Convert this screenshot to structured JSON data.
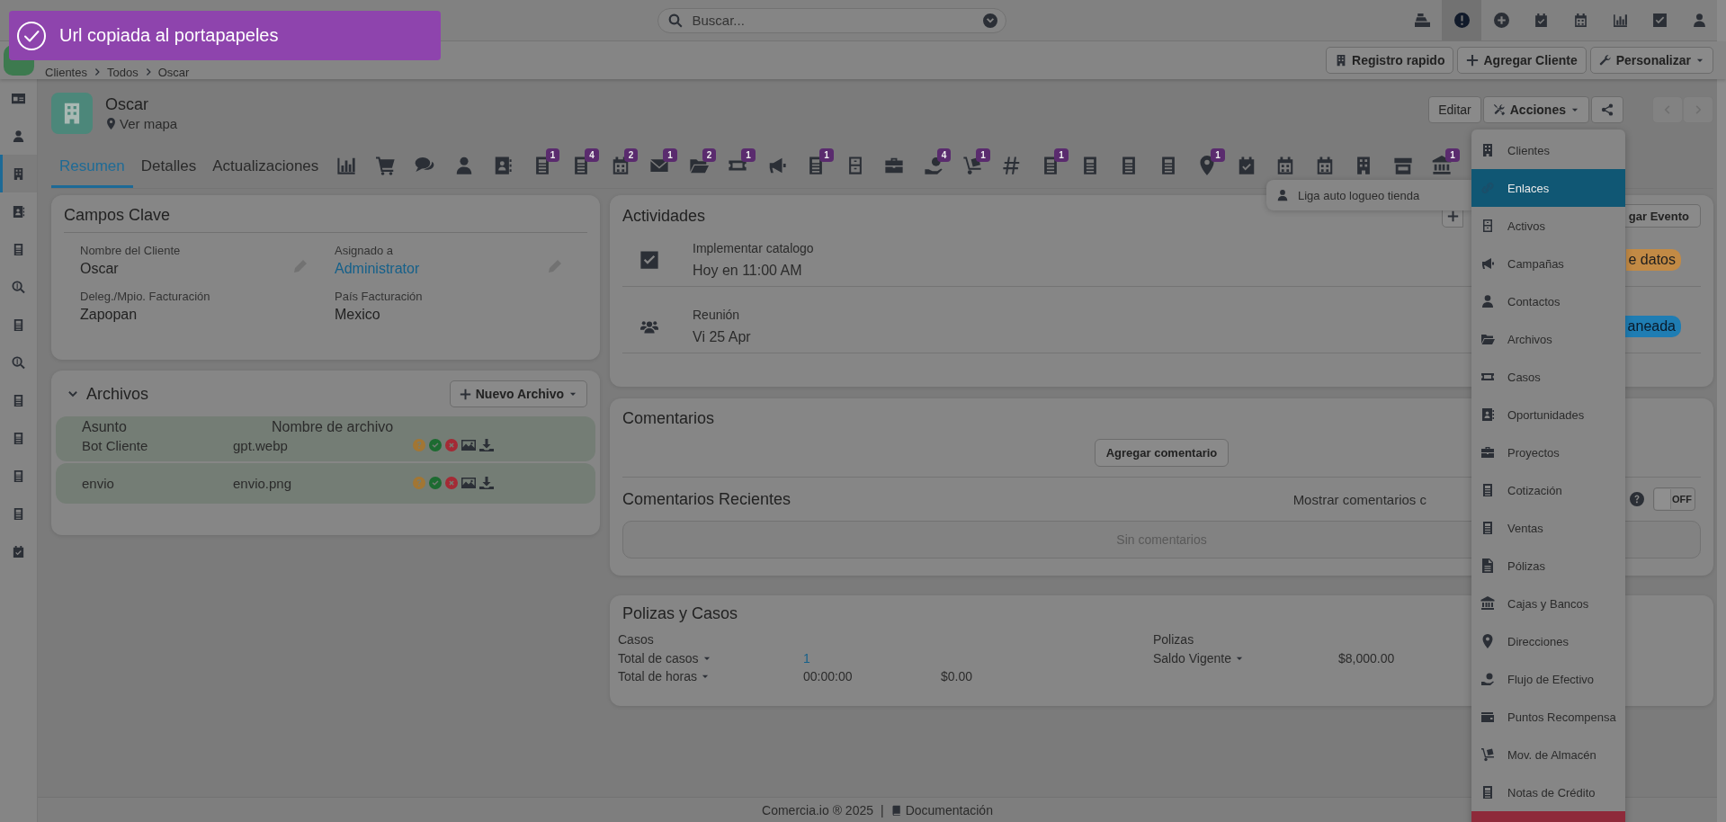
{
  "toast": {
    "message": "Url copiada al portapapeles"
  },
  "search": {
    "placeholder": "Buscar..."
  },
  "top_icons": [
    {
      "selected": false
    },
    {
      "selected": true
    },
    {
      "selected": false
    },
    {
      "selected": false
    },
    {
      "selected": false
    },
    {
      "selected": false
    },
    {
      "selected": false
    },
    {
      "selected": false
    }
  ],
  "breadcrumb": [
    "Clientes",
    "Todos",
    "Oscar"
  ],
  "toolbar_buttons": [
    "Registro rapido",
    "Agregar Cliente",
    "Personalizar"
  ],
  "sidebar": [
    {
      "selected": false
    },
    {
      "selected": false
    },
    {
      "selected": true
    },
    {
      "selected": false
    },
    {
      "selected": false
    },
    {
      "selected": false
    },
    {
      "selected": false
    },
    {
      "selected": false
    },
    {
      "selected": false
    },
    {
      "selected": false
    },
    {
      "selected": false
    },
    {
      "selected": false
    },
    {
      "selected": false
    }
  ],
  "record": {
    "name": "Oscar",
    "map_link": "Ver mapa",
    "edit_button": "Editar",
    "actions_button": "Acciones"
  },
  "tabs": [
    {
      "kind": "text",
      "label": "Resumen",
      "selected": true
    },
    {
      "kind": "text",
      "label": "Detalles",
      "selected": false
    },
    {
      "kind": "text",
      "label": "Actualizaciones",
      "selected": false
    },
    {
      "kind": "icon",
      "selected": false
    },
    {
      "kind": "icon",
      "selected": false
    },
    {
      "kind": "icon",
      "selected": false
    },
    {
      "kind": "icon",
      "selected": false
    },
    {
      "kind": "icon",
      "selected": false
    },
    {
      "kind": "icon",
      "selected": false,
      "badge": "1"
    },
    {
      "kind": "icon",
      "selected": false,
      "badge": "4"
    },
    {
      "kind": "icon",
      "selected": false,
      "badge": "2"
    },
    {
      "kind": "icon",
      "selected": false,
      "badge": "1"
    },
    {
      "kind": "icon",
      "selected": false,
      "badge": "2"
    },
    {
      "kind": "icon",
      "selected": false,
      "badge": "1"
    },
    {
      "kind": "icon",
      "selected": false
    },
    {
      "kind": "icon",
      "selected": false,
      "badge": "1"
    },
    {
      "kind": "icon",
      "selected": false
    },
    {
      "kind": "icon",
      "selected": false
    },
    {
      "kind": "icon",
      "selected": false,
      "badge": "4"
    },
    {
      "kind": "icon",
      "selected": false,
      "badge": "1"
    },
    {
      "kind": "icon",
      "selected": false
    },
    {
      "kind": "icon",
      "selected": false,
      "badge": "1"
    },
    {
      "kind": "icon",
      "selected": false
    },
    {
      "kind": "icon",
      "selected": false
    },
    {
      "kind": "icon",
      "selected": false
    },
    {
      "kind": "icon",
      "selected": false,
      "badge": "1"
    },
    {
      "kind": "icon",
      "selected": false
    },
    {
      "kind": "icon",
      "selected": false
    },
    {
      "kind": "icon",
      "selected": false
    },
    {
      "kind": "icon",
      "selected": false
    },
    {
      "kind": "icon",
      "selected": false
    },
    {
      "kind": "icon",
      "selected": false,
      "badge": "1"
    }
  ],
  "key_fields": {
    "title": "Campos Clave",
    "fields": [
      {
        "label": "Nombre del Cliente",
        "value": "Oscar",
        "link": false,
        "editable": true
      },
      {
        "label": "Asignado a",
        "value": "Administrator",
        "link": true,
        "editable": true
      },
      {
        "label": "Deleg./Mpio. Facturación",
        "value": "Zapopan",
        "link": false,
        "editable": false
      },
      {
        "label": "País Facturación",
        "value": "Mexico",
        "link": false,
        "editable": false
      }
    ]
  },
  "files": {
    "title": "Archivos",
    "expanded": true,
    "new_button": "Nuevo Archivo",
    "columns": [
      "Asunto",
      "Nombre de archivo"
    ],
    "rows": [
      {
        "subject": "Bot Cliente",
        "file": "gpt.webp"
      },
      {
        "subject": "envio",
        "file": "envio.png"
      }
    ]
  },
  "activities": {
    "title": "Actividades",
    "add_button": "gar Evento",
    "items": [
      {
        "kind": "task",
        "title": "Implementar catalogo",
        "when": "Hoy en 11:00 AM",
        "tag": "e datos",
        "color": "#c28a45"
      },
      {
        "kind": "meeting",
        "title": "Reunión",
        "when": "Vi 25 Apr",
        "tag": "aneada",
        "color": "#1f7db3"
      }
    ]
  },
  "comments": {
    "title": "Comentarios",
    "add_button": "Agregar comentario",
    "recent_title": "Comentarios Recientes",
    "show_label": "Mostrar comentarios c",
    "toggle": {
      "on": false,
      "label": "OFF"
    },
    "empty": "Sin comentarios"
  },
  "policies": {
    "title": "Polizas y Casos",
    "groups": [
      {
        "title": "Casos",
        "rows": [
          {
            "label": "Total de casos",
            "values": [
              "1"
            ],
            "link": true
          },
          {
            "label": "Total de horas",
            "values": [
              "00:00:00",
              "$0.00"
            ],
            "link": false
          }
        ]
      },
      {
        "title": "Polizas",
        "rows": [
          {
            "label": "Saldo Vigente",
            "values": [
              "$8,000.00"
            ],
            "link": false
          }
        ]
      }
    ]
  },
  "submenu": {
    "label": "Liga auto logueo tienda"
  },
  "actions_menu": [
    {
      "kind": "item",
      "label": "Clientes",
      "selected": false
    },
    {
      "kind": "item",
      "label": "Enlaces",
      "selected": true
    },
    {
      "kind": "item",
      "label": "Activos",
      "selected": false
    },
    {
      "kind": "item",
      "label": "Campañas",
      "selected": false
    },
    {
      "kind": "item",
      "label": "Contactos",
      "selected": false
    },
    {
      "kind": "item",
      "label": "Archivos",
      "selected": false
    },
    {
      "kind": "item",
      "label": "Casos",
      "selected": false
    },
    {
      "kind": "item",
      "label": "Oportunidades",
      "selected": false
    },
    {
      "kind": "item",
      "label": "Proyectos",
      "selected": false
    },
    {
      "kind": "item",
      "label": "Cotización",
      "selected": false
    },
    {
      "kind": "item",
      "label": "Ventas",
      "selected": false
    },
    {
      "kind": "item",
      "label": "Pólizas",
      "selected": false
    },
    {
      "kind": "item",
      "label": "Cajas y Bancos",
      "selected": false
    },
    {
      "kind": "item",
      "label": "Direcciones",
      "selected": false
    },
    {
      "kind": "item",
      "label": "Flujo de Efectivo",
      "selected": false
    },
    {
      "kind": "item",
      "label": "Puntos Recompensa",
      "selected": false
    },
    {
      "kind": "item",
      "label": "Mov. de Almacén",
      "selected": false
    },
    {
      "kind": "item",
      "label": "Notas de Crédito",
      "selected": false
    },
    {
      "kind": "danger"
    }
  ],
  "footer": {
    "copyright": "Comercia.io ® 2025",
    "separator": "|",
    "docs": "Documentación"
  }
}
